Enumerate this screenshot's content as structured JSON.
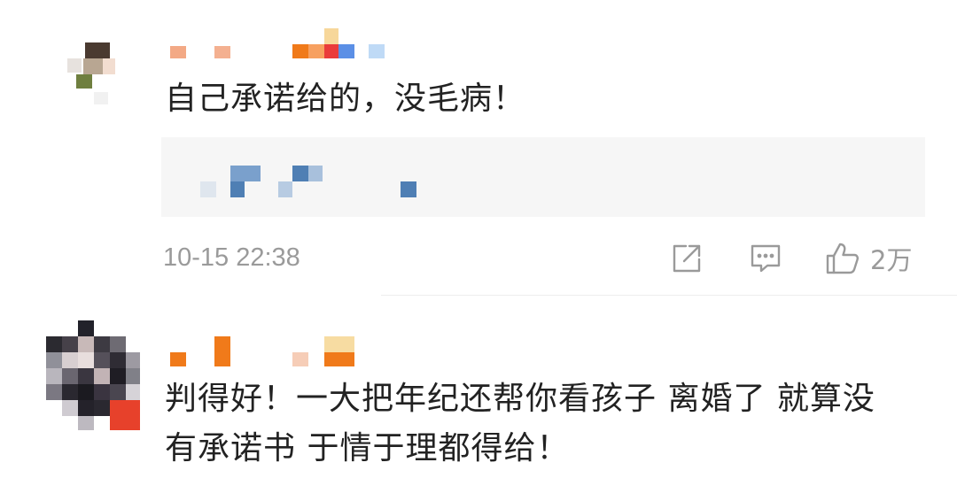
{
  "comments": [
    {
      "text": "自己承诺给的，没毛病！",
      "timestamp": "10-15 22:38",
      "actions": {
        "share_icon": "share-icon",
        "reply_icon": "comment-icon",
        "like_icon": "thumbs-up-icon",
        "like_count": "2万"
      }
    },
    {
      "text_line1": "判得好！一大把年纪还帮你看孩子 离婚了 就算没",
      "text_line2": "有承诺书 于情于理都得给！"
    }
  ]
}
